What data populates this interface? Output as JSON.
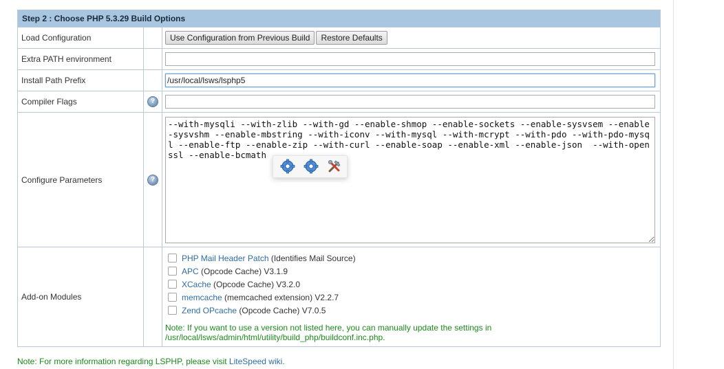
{
  "header": {
    "title": "Step 2 : Choose PHP 5.3.29 Build Options"
  },
  "rows": {
    "load_config": {
      "label": "Load Configuration",
      "btn_previous": "Use Configuration from Previous Build",
      "btn_restore": "Restore Defaults"
    },
    "extra_path": {
      "label": "Extra PATH environment",
      "value": ""
    },
    "install_prefix": {
      "label": "Install Path Prefix",
      "value": "/usr/local/lsws/lsphp5"
    },
    "compiler_flags": {
      "label": "Compiler Flags",
      "value": ""
    },
    "configure_params": {
      "label": "Configure Parameters",
      "value": "--with-mysqli --with-zlib --with-gd --enable-shmop --enable-sockets --enable-sysvsem --enable-sysvshm --enable-mbstring --with-iconv --with-mysql --with-mcrypt --with-pdo --with-pdo-mysql --enable-ftp --enable-zip --with-curl --enable-soap --enable-xml --enable-json  --with-openssl --enable-bcmath"
    },
    "addon_modules": {
      "label": "Add-on Modules",
      "items": [
        {
          "name": "PHP Mail Header Patch",
          "desc": " (Identifies Mail Source)",
          "checked": false
        },
        {
          "name": "APC",
          "desc": " (Opcode Cache) V3.1.9",
          "checked": false
        },
        {
          "name": "XCache",
          "desc": " (Opcode Cache) V3.2.0",
          "checked": false
        },
        {
          "name": "memcache",
          "desc": " (memcached extension) V2.2.7",
          "checked": false
        },
        {
          "name": "Zend OPcache",
          "desc": " (Opcode Cache) V7.0.5",
          "checked": false
        }
      ],
      "note_line1": "Note: If you want to use a version not listed here, you can manually update the settings in",
      "note_line2": "/usr/local/lsws/admin/html/utility/build_php/buildconf.inc.php."
    }
  },
  "footer": {
    "note_prefix": "Note: For more information regarding LSPHP, please visit ",
    "link_text": "LiteSpeed wiki",
    "note_suffix": "."
  },
  "icons": {
    "help": "help-icon",
    "toolbar": [
      "gear-icon",
      "gear-icon",
      "tools-icon"
    ]
  },
  "colors": {
    "header_bg": "#a8c6e0",
    "border": "#b8cad9",
    "link": "#2e6da4",
    "note": "#1a8a1a"
  }
}
